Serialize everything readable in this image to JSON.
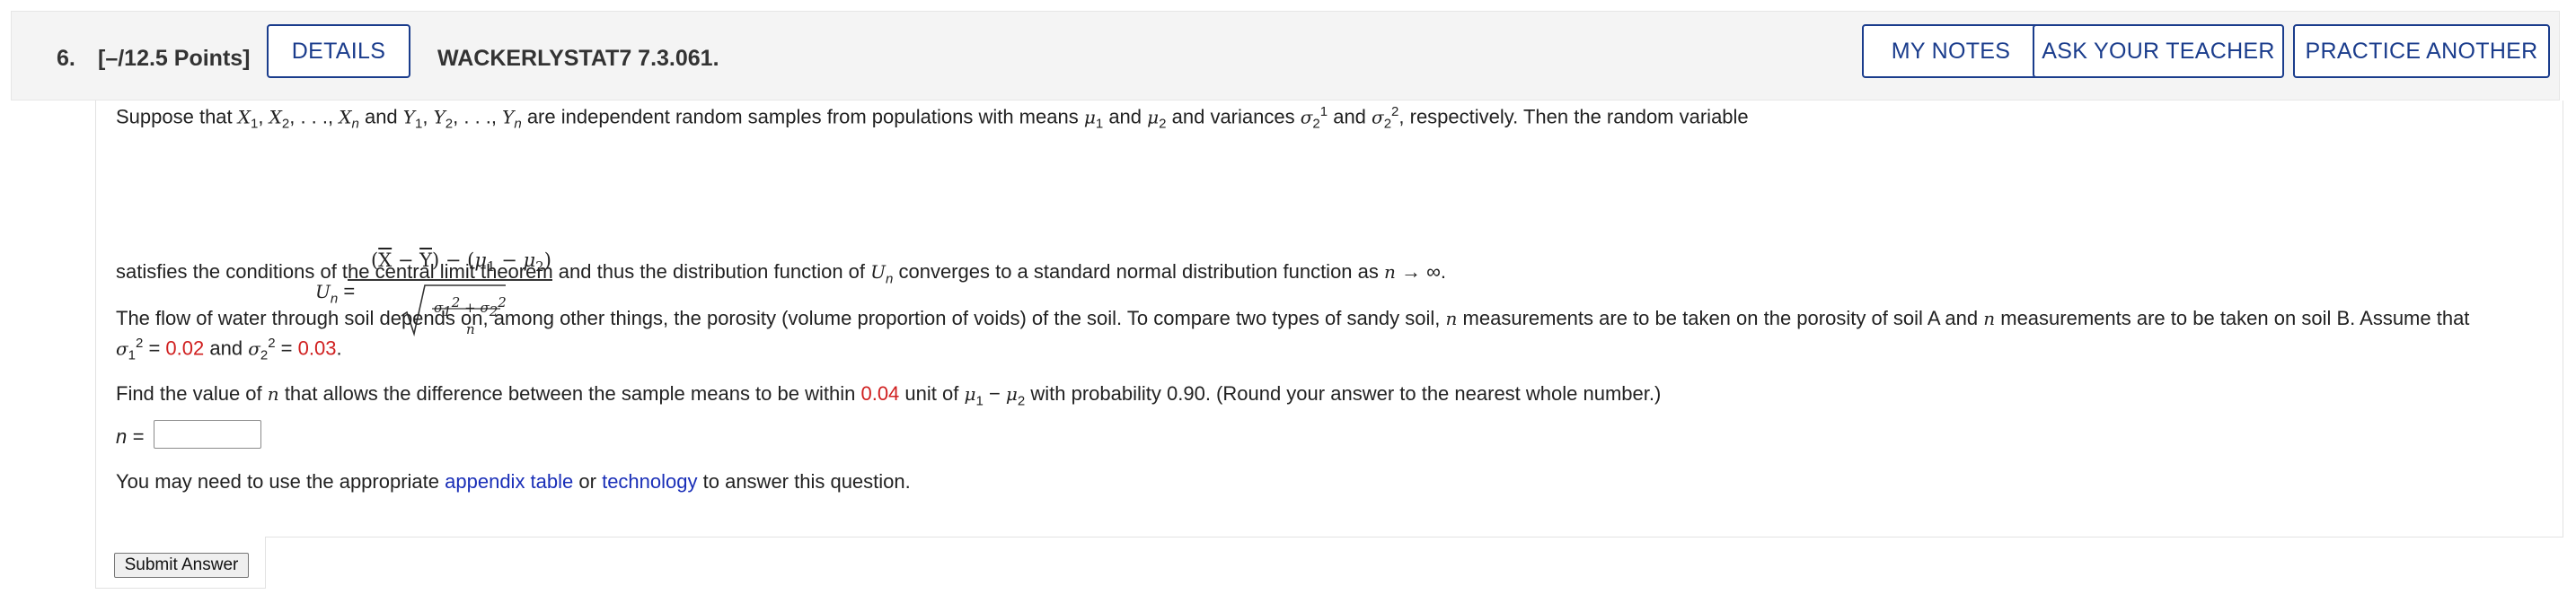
{
  "header": {
    "question_number": "6.",
    "points": "[–/12.5 Points]",
    "details_label": "DETAILS",
    "source": "WACKERLYSTAT7 7.3.061.",
    "my_notes_label": "MY NOTES",
    "ask_teacher_label": "ASK YOUR TEACHER",
    "practice_label": "PRACTICE ANOTHER"
  },
  "body": {
    "intro_prefix": "Suppose that",
    "intro_mid": "are independent random samples from populations with means",
    "intro_vars": "and variances",
    "intro_end": ", respectively. Then the random variable",
    "and": "and",
    "clt_prefix": "satisfies the conditions of the central limit theorem and thus the distribution function of",
    "clt_suffix": "converges to a standard normal distribution function as",
    "flow_line1": "The flow of water through soil depends on, among other things, the porosity (volume proportion of voids) of the soil. To compare two types of sandy soil,",
    "flow_line1_b": "measurements are to be taken on the porosity of soil A and",
    "flow_line1_c": "measurements are to be taken on soil B. Assume that",
    "sigma1_value": "0.02",
    "sigma2_value": "0.03",
    "find_prefix": "Find the value of",
    "find_mid": "that allows the difference between the sample means to be within",
    "within_value": "0.04",
    "find_unit": "unit of",
    "find_end": "with probability 0.90. (Round your answer to the nearest whole number.)",
    "n_label": "n =",
    "help_prefix": "You may need to use the appropriate",
    "appendix_link": "appendix table",
    "or": "or",
    "technology_link": "technology",
    "help_suffix": "to answer this question."
  },
  "submit_label": "Submit Answer",
  "colors": {
    "accent": "#1a3c8c",
    "highlight": "#d01f1f",
    "link": "#1a2fb8"
  }
}
